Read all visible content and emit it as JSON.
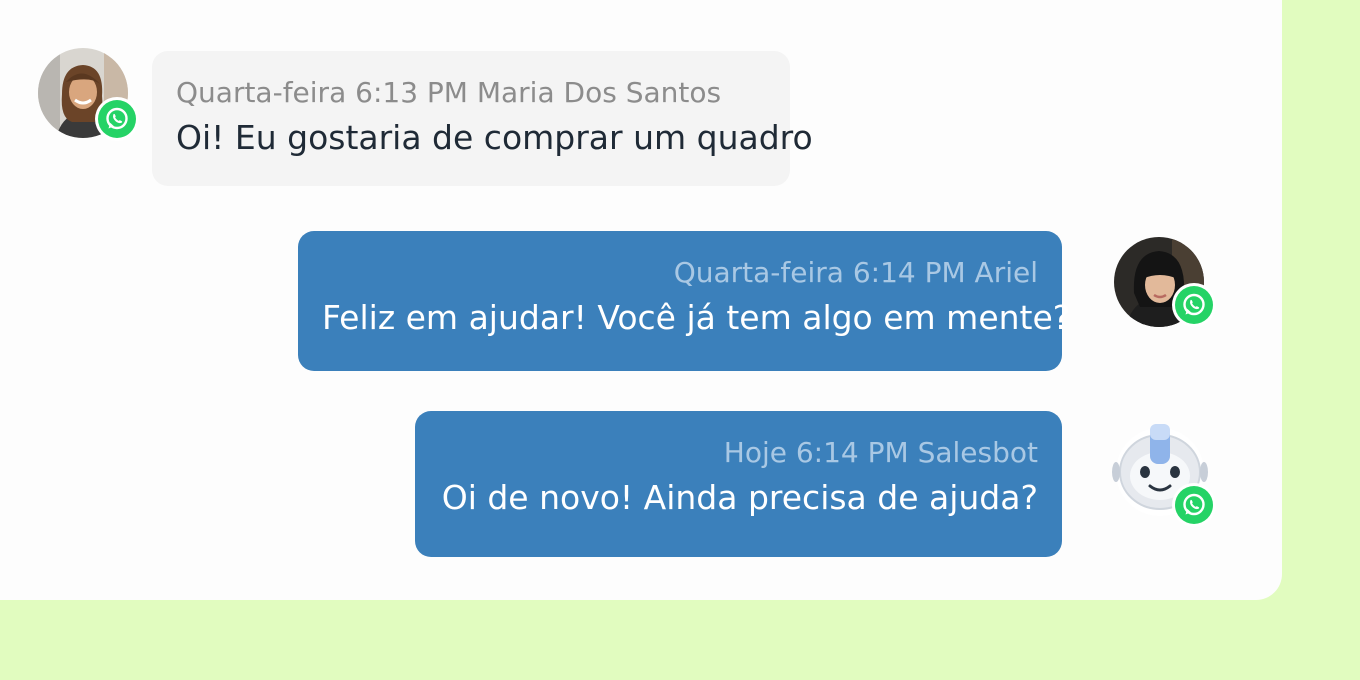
{
  "messages": [
    {
      "direction": "incoming",
      "day": "Quarta-feira",
      "time": "6:13 PM",
      "author": "Maria Dos Santos",
      "meta": "Quarta-feira 6:13 PM Maria Dos Santos",
      "text": "Oi! Eu gostaria de comprar um quadro",
      "channel": "whatsapp"
    },
    {
      "direction": "outgoing",
      "day": "Quarta-feira",
      "time": "6:14 PM",
      "author": "Ariel",
      "meta": "Quarta-feira 6:14 PM Ariel",
      "text": "Feliz em ajudar! Você já tem algo em mente?",
      "channel": "whatsapp"
    },
    {
      "direction": "outgoing",
      "day": "Hoje",
      "time": "6:14 PM",
      "author": "Salesbot",
      "meta": "Hoje 6:14 PM Salesbot",
      "text": "Oi de novo! Ainda precisa de ajuda?",
      "channel": "whatsapp"
    }
  ],
  "colors": {
    "page_background": "#e1fcbf",
    "panel_background": "#fdfdfd",
    "incoming_bubble": "#f4f4f4",
    "outgoing_bubble": "#3b80bb",
    "whatsapp_green": "#25d366"
  },
  "icons": {
    "channel_badge": "whatsapp-icon",
    "bot_avatar": "robot-icon"
  }
}
